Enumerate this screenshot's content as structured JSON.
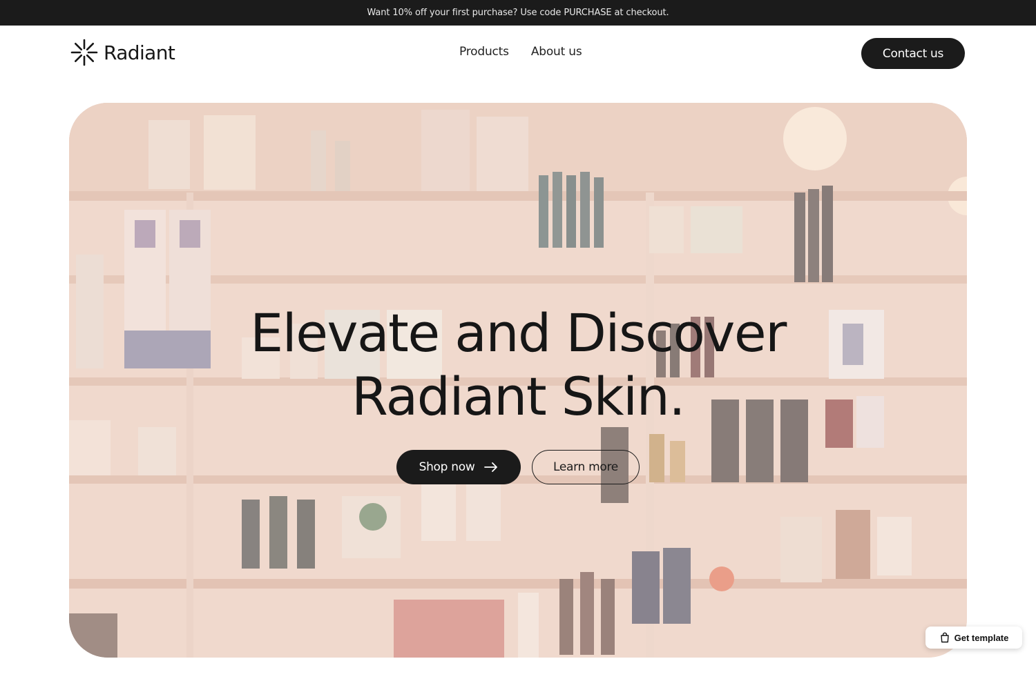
{
  "announcement": {
    "text": "Want 10% off your first purchase? Use code PURCHASE at checkout."
  },
  "brand": {
    "name": "Radiant",
    "logo_icon": "asterisk-burst-icon"
  },
  "nav": {
    "items": [
      {
        "label": "Products"
      },
      {
        "label": "About us"
      }
    ],
    "contact_label": "Contact us"
  },
  "hero": {
    "headline_line1": "Elevate and Discover",
    "headline_line2": "Radiant Skin.",
    "shop_label": "Shop now",
    "shop_icon": "arrow-right-icon",
    "learn_label": "Learn more",
    "background": "skincare-shop-shelves-photo"
  },
  "badge": {
    "label": "Get template",
    "icon": "shopping-bag-icon"
  },
  "colors": {
    "dark": "#1b1b1b",
    "text": "#171717",
    "hero_tint": "#f4dccf",
    "white": "#ffffff"
  }
}
